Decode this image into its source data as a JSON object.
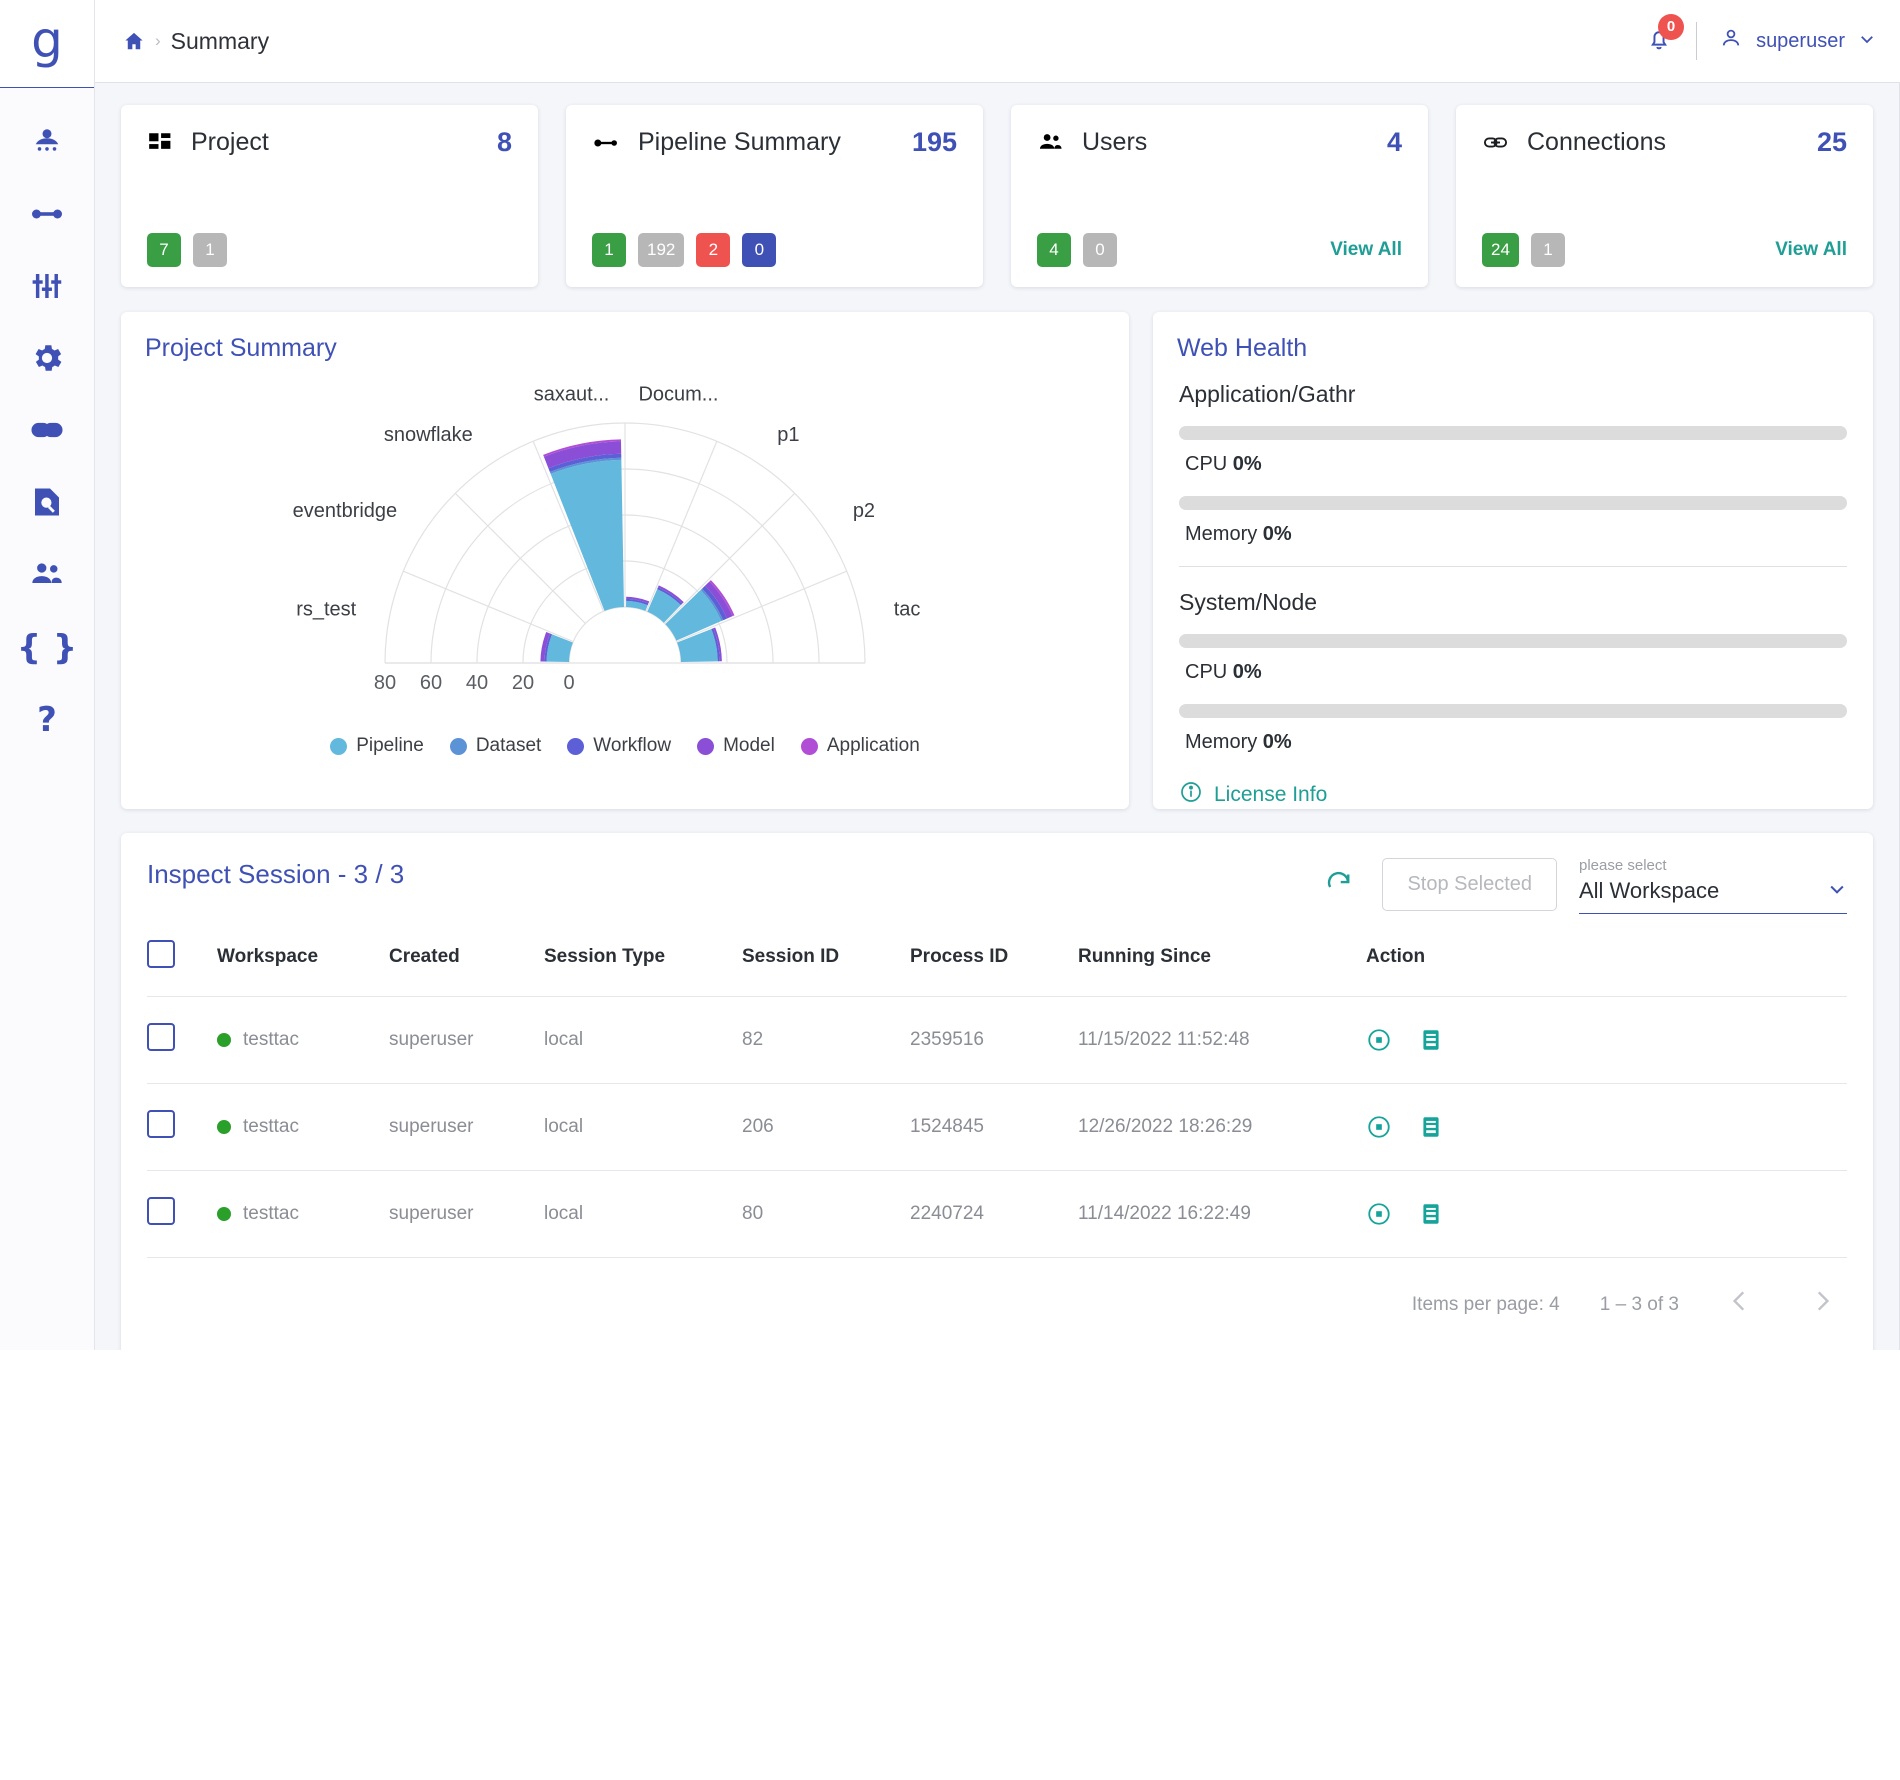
{
  "brand": {
    "logo": "g"
  },
  "sidebar": {
    "items": [
      {
        "name": "workspace-icon",
        "label": "Workspace"
      },
      {
        "name": "pipeline-icon",
        "label": "Pipeline"
      },
      {
        "name": "tuning-icon",
        "label": "Tuning"
      },
      {
        "name": "settings-icon",
        "label": "Settings"
      },
      {
        "name": "connections-icon",
        "label": "Connections"
      },
      {
        "name": "inspect-icon",
        "label": "Inspect"
      },
      {
        "name": "users-icon",
        "label": "Users"
      },
      {
        "name": "code-icon",
        "label": "{ }"
      },
      {
        "name": "help-icon",
        "label": "?"
      }
    ]
  },
  "topbar": {
    "breadcrumb_home": "home-icon",
    "breadcrumb_sep": "›",
    "breadcrumb_text": "Summary",
    "notifications_count": "0",
    "user_name": "superuser",
    "chevron": "⌄"
  },
  "cards": [
    {
      "icon": "dashboard-icon",
      "title": "Project",
      "count": "8",
      "chips": [
        {
          "value": "7",
          "color": "green"
        },
        {
          "value": "1",
          "color": "grey"
        }
      ],
      "link": ""
    },
    {
      "icon": "pipeline-icon",
      "title": "Pipeline Summary",
      "count": "195",
      "chips": [
        {
          "value": "1",
          "color": "green"
        },
        {
          "value": "192",
          "color": "grey"
        },
        {
          "value": "2",
          "color": "red"
        },
        {
          "value": "0",
          "color": "blue"
        }
      ],
      "link": ""
    },
    {
      "icon": "users-icon",
      "title": "Users",
      "count": "4",
      "chips": [
        {
          "value": "4",
          "color": "green"
        },
        {
          "value": "0",
          "color": "grey"
        }
      ],
      "link": "View All"
    },
    {
      "icon": "link-icon",
      "title": "Connections",
      "count": "25",
      "chips": [
        {
          "value": "24",
          "color": "green"
        },
        {
          "value": "1",
          "color": "grey"
        }
      ],
      "link": "View All"
    }
  ],
  "project_summary": {
    "title": "Project Summary"
  },
  "chart_data": {
    "type": "bar",
    "subtype": "polar-stacked-semicircle",
    "title": "Project Summary",
    "xlabel": "",
    "ylabel": "",
    "rlim": [
      0,
      90
    ],
    "r_ticks": [
      "80",
      "60",
      "40",
      "20",
      "0"
    ],
    "grid": true,
    "legend_position": "bottom",
    "categories": [
      "tac",
      "p2",
      "p1",
      "Docum...",
      "saxaut...",
      "snowflake",
      "eventbridge",
      "rs_test"
    ],
    "series": [
      {
        "name": "Pipeline",
        "color": "#62b9dd",
        "values": [
          18,
          24,
          12,
          3,
          72,
          0,
          0,
          11
        ]
      },
      {
        "name": "Dataset",
        "color": "#5b93d6",
        "values": [
          0,
          1,
          0,
          0,
          1,
          0,
          0,
          0
        ]
      },
      {
        "name": "Workflow",
        "color": "#5c5fd6",
        "values": [
          1,
          2,
          1,
          1,
          2,
          0,
          0,
          1
        ]
      },
      {
        "name": "Model",
        "color": "#8a4fd6",
        "values": [
          1,
          3,
          1,
          1,
          6,
          0,
          0,
          2
        ]
      },
      {
        "name": "Application",
        "color": "#b04fd6",
        "values": [
          0,
          1,
          0,
          0,
          1,
          0,
          0,
          0
        ]
      }
    ],
    "legend": [
      "Pipeline",
      "Dataset",
      "Workflow",
      "Model",
      "Application"
    ]
  },
  "web_health": {
    "title": "Web Health",
    "groups": [
      {
        "name": "Application/Gathr",
        "metrics": [
          {
            "label": "CPU",
            "value": "0%",
            "percent": 0
          },
          {
            "label": "Memory",
            "value": "0%",
            "percent": 0
          }
        ]
      },
      {
        "name": "System/Node",
        "metrics": [
          {
            "label": "CPU",
            "value": "0%",
            "percent": 0
          },
          {
            "label": "Memory",
            "value": "0%",
            "percent": 0
          }
        ]
      }
    ],
    "license_label": "License Info"
  },
  "session": {
    "title": "Inspect Session - 3 / 3",
    "refresh_icon": "refresh-icon",
    "stop_button": "Stop Selected",
    "select_placeholder": "please select",
    "select_value": "All Workspace",
    "columns": [
      "Workspace",
      "Created",
      "Session Type",
      "Session ID",
      "Process ID",
      "Running Since",
      "Action"
    ],
    "rows": [
      {
        "workspace": "testtac",
        "created": "superuser",
        "session_type": "local",
        "session_id": "82",
        "process_id": "2359516",
        "running_since": "11/15/2022 11:52:48"
      },
      {
        "workspace": "testtac",
        "created": "superuser",
        "session_type": "local",
        "session_id": "206",
        "process_id": "1524845",
        "running_since": "12/26/2022 18:26:29"
      },
      {
        "workspace": "testtac",
        "created": "superuser",
        "session_type": "local",
        "session_id": "80",
        "process_id": "2240724",
        "running_since": "11/14/2022 16:22:49"
      }
    ],
    "pagination": {
      "items_per_page_label": "Items per page: 4",
      "range_label": "1 – 3 of 3",
      "prev": "‹",
      "next": "›"
    }
  },
  "colors": {
    "accent": "#3f51b5",
    "teal": "#1f9e95",
    "green": "#3a9e45",
    "red": "#ef5350",
    "grey": "#b7b7b7"
  }
}
